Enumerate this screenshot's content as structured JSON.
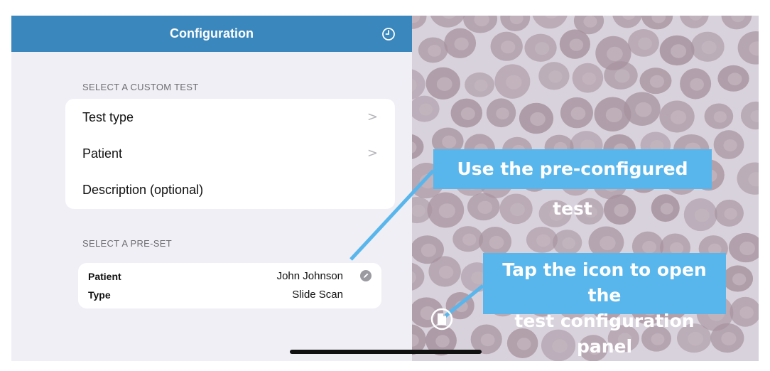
{
  "nav": {
    "title": "Configuration",
    "history_icon": "clock-icon"
  },
  "custom_test": {
    "header": "SELECT A CUSTOM TEST",
    "rows": [
      {
        "label": "Test type",
        "chevron": ">"
      },
      {
        "label": "Patient",
        "chevron": ">"
      },
      {
        "label": "Description (optional)"
      }
    ]
  },
  "preset": {
    "header": "SELECT A PRE-SET",
    "patient_key": "Patient",
    "patient_value": "John Johnson",
    "type_key": "Type",
    "type_value": "Slide Scan",
    "edit_icon": "pencil-icon"
  },
  "callouts": {
    "preconfigured": "Use the pre-configured test",
    "tap_line1": "Tap the icon to open the",
    "tap_line2": "test configuration panel"
  },
  "camera": {
    "config_icon": "document-icon"
  },
  "colors": {
    "nav_bar": "#3a87bd",
    "callout": "#58b6ec",
    "panel_bg": "#f0eff5"
  }
}
